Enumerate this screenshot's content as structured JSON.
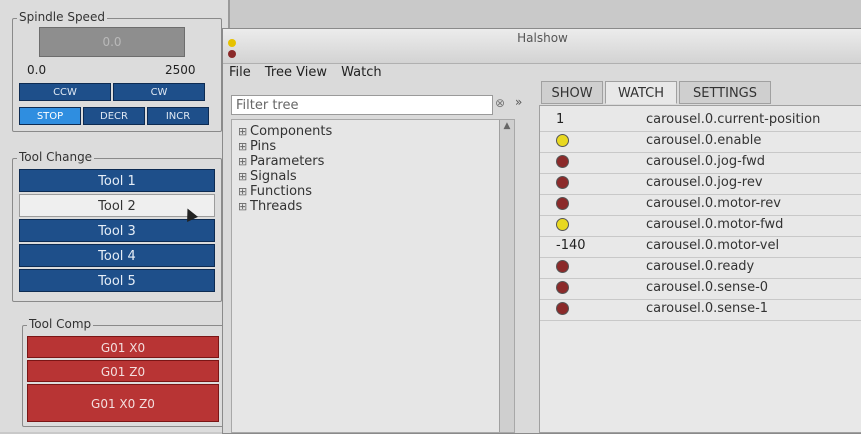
{
  "spindle": {
    "title": "Spindle Speed",
    "display": "0.0",
    "min": "0.0",
    "max": "2500",
    "buttons": [
      "CCW",
      "CW",
      "STOP",
      "DECR",
      "INCR"
    ]
  },
  "tool_change": {
    "title": "Tool Change",
    "tools": [
      "Tool 1",
      "Tool 2",
      "Tool 3",
      "Tool 4",
      "Tool 5"
    ]
  },
  "tool_comp": {
    "title": "Tool Comp",
    "buttons": [
      "G01 X0",
      "G01 Z0",
      "G01 X0 Z0"
    ]
  },
  "halshow": {
    "title": "Halshow",
    "menu": [
      "File",
      "Tree View",
      "Watch"
    ],
    "filter_placeholder": "Filter tree",
    "expand": "»",
    "tree": [
      "Components",
      "Pins",
      "Parameters",
      "Signals",
      "Functions",
      "Threads"
    ],
    "tabs": [
      "SHOW",
      "WATCH",
      "SETTINGS"
    ],
    "watch": [
      {
        "value": "1",
        "name": "carousel.0.current-position"
      },
      {
        "led": "on",
        "name": "carousel.0.enable"
      },
      {
        "led": "off",
        "name": "carousel.0.jog-fwd"
      },
      {
        "led": "off",
        "name": "carousel.0.jog-rev"
      },
      {
        "led": "off",
        "name": "carousel.0.motor-rev"
      },
      {
        "led": "on",
        "name": "carousel.0.motor-fwd"
      },
      {
        "value": "-140",
        "name": "carousel.0.motor-vel"
      },
      {
        "led": "off",
        "name": "carousel.0.ready"
      },
      {
        "led": "off",
        "name": "carousel.0.sense-0"
      },
      {
        "led": "off",
        "name": "carousel.0.sense-1"
      }
    ]
  },
  "colors": {
    "led_on": "#e8d820",
    "led_off": "#8b2a2a",
    "tool_blue": "#1e4f8a",
    "comp_red": "#b83434"
  }
}
